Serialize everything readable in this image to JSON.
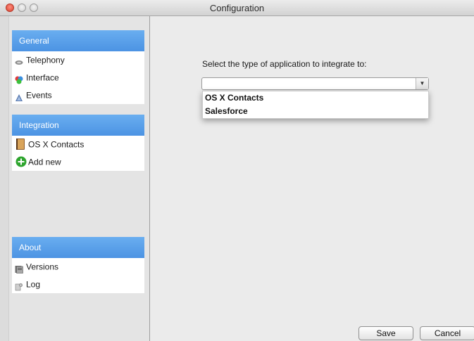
{
  "window": {
    "title": "Configuration"
  },
  "sidebar": {
    "groups": [
      {
        "header": "General",
        "items": [
          {
            "label": "Telephony",
            "icon": "telephony-icon"
          },
          {
            "label": "Interface",
            "icon": "interface-icon"
          },
          {
            "label": "Events",
            "icon": "events-icon"
          }
        ]
      },
      {
        "header": "Integration",
        "items": [
          {
            "label": "OS X Contacts",
            "icon": "address-book-icon"
          },
          {
            "label": "Add new",
            "icon": "add-icon"
          }
        ]
      },
      {
        "header": "About",
        "items": [
          {
            "label": "Versions",
            "icon": "versions-icon"
          },
          {
            "label": "Log",
            "icon": "log-icon"
          }
        ]
      }
    ]
  },
  "main": {
    "prompt": "Select the type of application to integrate to:",
    "select_value": "",
    "options": [
      "OS X Contacts",
      "Salesforce"
    ]
  },
  "buttons": {
    "save": "Save",
    "cancel": "Cancel"
  },
  "colors": {
    "accent": "#4c93e3",
    "close": "#d9412f",
    "add": "#2ea52e"
  }
}
